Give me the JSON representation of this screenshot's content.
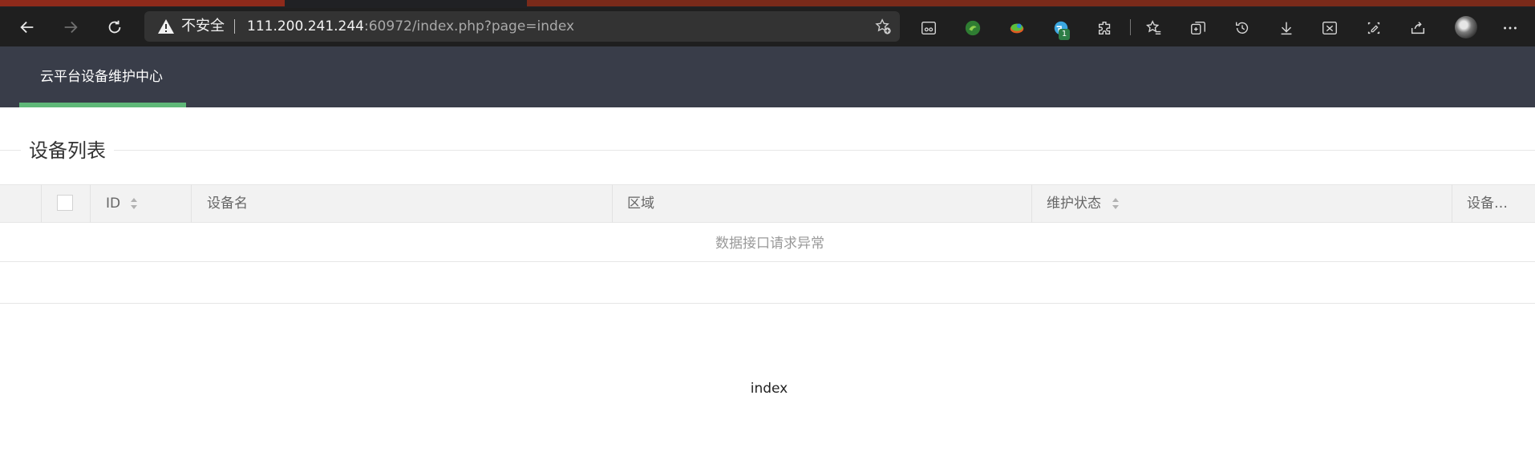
{
  "browser": {
    "security_label": "不安全",
    "url_host": "111.200.241.244",
    "url_rest": ":60972/index.php?page=index",
    "extension_badge": "1",
    "colors": {
      "toolbar": "#1f1f1f",
      "address_bar": "#333333"
    }
  },
  "app": {
    "nav_title": "云平台设备维护中心",
    "colors": {
      "header": "#393d49",
      "active_bar": "#5fb878"
    }
  },
  "fieldset": {
    "title": "设备列表"
  },
  "table": {
    "columns": [
      "ID",
      "设备名",
      "区域",
      "维护状态",
      "设备…"
    ],
    "sortable": [
      "ID",
      "维护状态"
    ],
    "empty_message": "数据接口请求异常"
  },
  "footer": {
    "text": "index"
  }
}
